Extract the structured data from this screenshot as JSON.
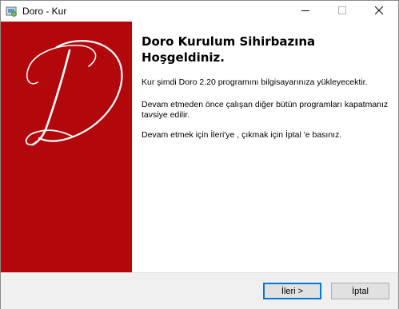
{
  "window": {
    "title": "Doro - Kur",
    "icon": "installer-icon"
  },
  "titlebar_buttons": {
    "minimize_icon": "minimize-icon",
    "maximize_icon": "maximize-icon",
    "close_icon": "close-icon"
  },
  "sidebar": {
    "background_color": "#b3080b",
    "logo_letter": "D"
  },
  "content": {
    "heading": "Doro Kurulum Sihirbazına Hoşgeldiniz.",
    "paragraph1": "Kur şimdi Doro 2.20 programını bilgisayarınıza yükleyecektir.",
    "paragraph2": "Devam etmeden önce çalışan diğer bütün programları kapatmanız tavsiye edilir.",
    "paragraph3": "Devam etmek için İleri'ye , çıkmak için İptal 'e basınız."
  },
  "footer": {
    "next_label": "İleri >",
    "cancel_label": "İptal"
  }
}
